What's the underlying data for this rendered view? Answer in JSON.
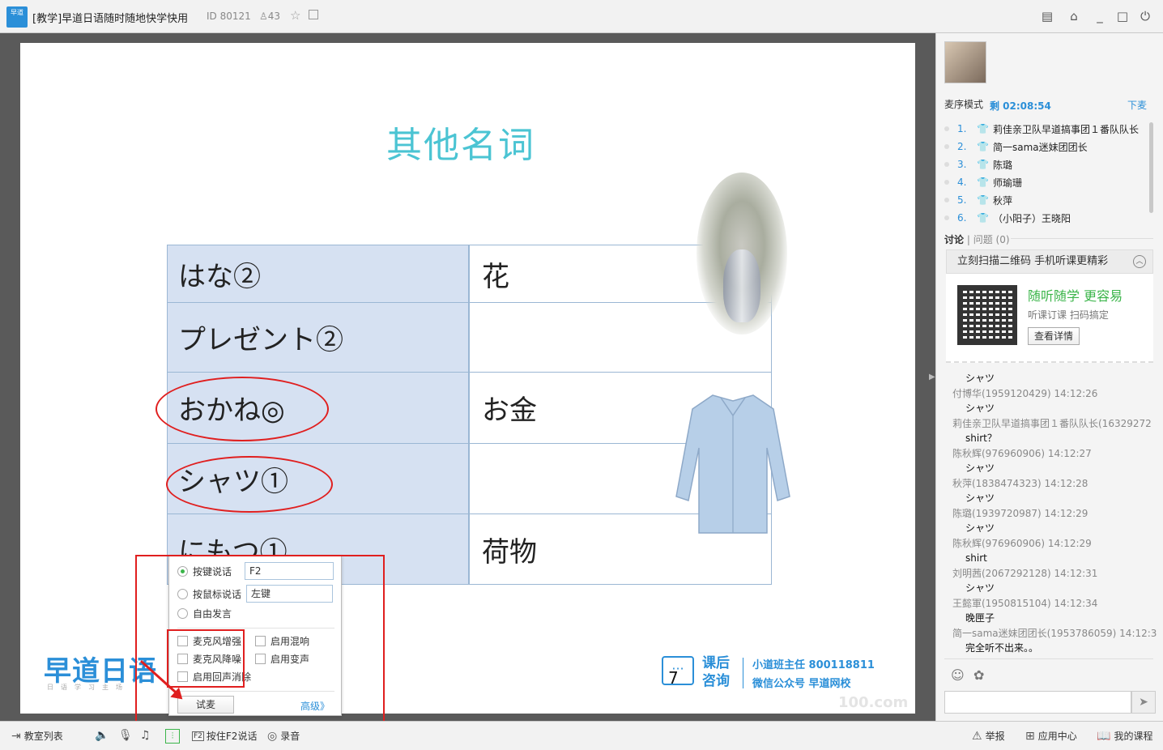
{
  "window": {
    "app_logo": "早道",
    "title": "[教学]早道日语随时随地快学快用",
    "room_id": "ID 80121",
    "user_count": "43",
    "icons": [
      "list-icon",
      "home-icon",
      "minimize-icon",
      "maximize-icon",
      "power-icon"
    ]
  },
  "slide": {
    "title": "其他名词",
    "rows": [
      {
        "jp": "はな②",
        "cn": "花"
      },
      {
        "jp": "プレゼント②",
        "cn": ""
      },
      {
        "jp": "おかね◎",
        "cn": "お金"
      },
      {
        "jp": "シャツ①",
        "cn": ""
      },
      {
        "jp": "にもつ①",
        "cn": "荷物"
      }
    ],
    "logo_text": "早道日语",
    "logo_sub": "日语学习主场",
    "consult_main": "课后咨询",
    "consult_line1": "小道班主任  800118811",
    "consult_line2": "微信公众号  早道网校",
    "page_number": "7",
    "watermark": "100.com"
  },
  "mic_popup": {
    "options": [
      {
        "label": "按键说话",
        "value": "F2",
        "selected": true
      },
      {
        "label": "按鼠标说话",
        "value": "左键",
        "selected": false
      },
      {
        "label": "自由发言",
        "selected": false
      }
    ],
    "checkboxes": {
      "mic_enhance": "麦克风增强",
      "mic_denoise": "麦克风降噪",
      "echo_cancel": "启用回声消除",
      "reverb": "启用混响",
      "voice_change": "启用变声"
    },
    "try_button": "试麦",
    "advanced_link": "高级》"
  },
  "sidebar": {
    "mode_label": "麦序模式",
    "remaining": "剩 02:08:54",
    "leave_mic": "下麦",
    "queue": [
      {
        "num": "1.",
        "name": "莉佳亲卫队早道搞事团１番队队长"
      },
      {
        "num": "2.",
        "name": "简一sama迷妹团团长"
      },
      {
        "num": "3.",
        "name": "陈璐"
      },
      {
        "num": "4.",
        "name": "师瑜珊"
      },
      {
        "num": "5.",
        "name": "秋萍"
      },
      {
        "num": "6.",
        "name": "（小阳子）王晓阳"
      }
    ],
    "tab_discuss": "讨论",
    "tab_question": "问题",
    "question_count": "(0)",
    "qr_header": "立刻扫描二维码 手机听课更精彩",
    "qr_title": "随听随学   更容易",
    "qr_sub": "听课订课    扫码搞定",
    "qr_button": "查看详情",
    "chat": [
      {
        "msg": "シャツ",
        "meta": "付博华(1959120429) 14:12:26"
      },
      {
        "msg": "シャツ",
        "meta": "莉佳亲卫队早道搞事团１番队队长(16329272"
      },
      {
        "msg": "shirt？",
        "meta": "陈秋辉(976960906) 14:12:27"
      },
      {
        "msg": "シャツ",
        "meta": "秋萍(1838474323) 14:12:28"
      },
      {
        "msg": "シャツ",
        "meta": "陈璐(1939720987) 14:12:29"
      },
      {
        "msg": "シャツ",
        "meta": "陈秋辉(976960906) 14:12:29"
      },
      {
        "msg": "shirt",
        "meta": "刘明茜(2067292128) 14:12:31"
      },
      {
        "msg": "シャツ",
        "meta": "王懿軍(1950815104) 14:12:34"
      },
      {
        "msg": "晚匣子",
        "meta": "简一sama迷妹团团长(1953786059) 14:12:3"
      },
      {
        "msg": "完全听不出来。。",
        "meta": ""
      }
    ]
  },
  "bottombar": {
    "classroom_list": "教室列表",
    "f2_key": "F2",
    "f2_talk": "按住F2说话",
    "record": "录音",
    "report": "举报",
    "app_center": "应用中心",
    "my_courses": "我的课程"
  },
  "colors": {
    "accent_blue": "#2b8fd8",
    "title_cyan": "#4bc4d3",
    "annotation_red": "#e01f1f",
    "table_fill": "#d6e1f2",
    "green": "#3bb54a"
  }
}
